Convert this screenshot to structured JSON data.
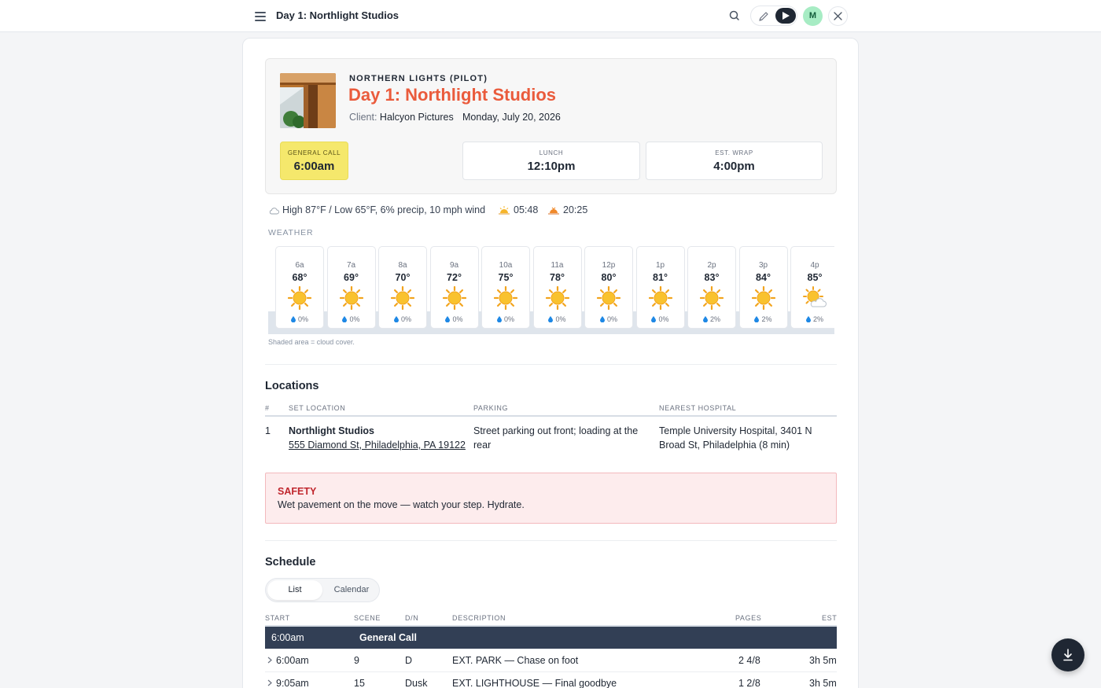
{
  "header": {
    "title": "Day 1: Northlight Studios",
    "avatar_initial": "M"
  },
  "hero": {
    "project": "NORTHERN LIGHTS (PILOT)",
    "day_title": "Day 1: Northlight Studios",
    "client_label": "Client:",
    "client_name": "Halcyon Pictures",
    "date": "Monday, July 20, 2026",
    "general_call_label": "GENERAL CALL",
    "general_call": "6:00am",
    "lunch_label": "LUNCH",
    "lunch": "12:10pm",
    "wrap_label": "EST. WRAP",
    "wrap": "4:00pm"
  },
  "weather": {
    "summary": "High 87°F / Low 65°F, 6% precip, 10 mph wind",
    "sunrise": "05:48",
    "sunset": "20:25",
    "section_label": "WEATHER",
    "note": "Shaded area = cloud cover.",
    "hours": [
      {
        "time": "6a",
        "temp": "68°",
        "precip": "0%",
        "icon": "sun-icon"
      },
      {
        "time": "7a",
        "temp": "69°",
        "precip": "0%",
        "icon": "sun-icon"
      },
      {
        "time": "8a",
        "temp": "70°",
        "precip": "0%",
        "icon": "sun-icon"
      },
      {
        "time": "9a",
        "temp": "72°",
        "precip": "0%",
        "icon": "sun-icon"
      },
      {
        "time": "10a",
        "temp": "75°",
        "precip": "0%",
        "icon": "sun-icon"
      },
      {
        "time": "11a",
        "temp": "78°",
        "precip": "0%",
        "icon": "sun-icon"
      },
      {
        "time": "12p",
        "temp": "80°",
        "precip": "0%",
        "icon": "sun-icon"
      },
      {
        "time": "1p",
        "temp": "81°",
        "precip": "0%",
        "icon": "sun-icon"
      },
      {
        "time": "2p",
        "temp": "83°",
        "precip": "2%",
        "icon": "sun-icon"
      },
      {
        "time": "3p",
        "temp": "84°",
        "precip": "2%",
        "icon": "sun-icon"
      },
      {
        "time": "4p",
        "temp": "85°",
        "precip": "2%",
        "icon": "partly-cloudy-icon"
      }
    ]
  },
  "locations": {
    "title": "Locations",
    "columns": [
      "#",
      "SET LOCATION",
      "PARKING",
      "NEAREST HOSPITAL"
    ],
    "rows": [
      {
        "num": "1",
        "name": "Northlight Studios",
        "address": "555 Diamond St, Philadelphia, PA 19122",
        "parking_line1": "Street parking out front; loading at the",
        "parking_line2": "rear",
        "hospital_line1": "Temple University Hospital, 3401 N",
        "hospital_line2": "Broad St, Philadelphia (8 min)"
      }
    ]
  },
  "safety": {
    "title": "SAFETY",
    "text": "Wet pavement on the move — watch your step. Hydrate."
  },
  "schedule": {
    "title": "Schedule",
    "tab_list": "List",
    "tab_calendar": "Calendar",
    "columns": [
      "START",
      "SCENE",
      "D/N",
      "DESCRIPTION",
      "PAGES",
      "EST"
    ],
    "call_row": {
      "time": "6:00am",
      "label": "General Call"
    },
    "rows": [
      {
        "start": "6:00am",
        "scene": "9",
        "dn": "D",
        "description": "EXT. PARK — Chase on foot",
        "pages": "2 4/8",
        "est": "3h 5m"
      },
      {
        "start": "9:05am",
        "scene": "15",
        "dn": "Dusk",
        "description": "EXT. LIGHTHOUSE — Final goodbye",
        "pages": "1 2/8",
        "est": "3h 5m"
      }
    ]
  },
  "colors": {
    "accent": "#ea5b3c",
    "call_highlight": "#f5e86c",
    "dark": "#323f55",
    "safety_bg": "#fdeced",
    "safety_text": "#c0262d"
  }
}
